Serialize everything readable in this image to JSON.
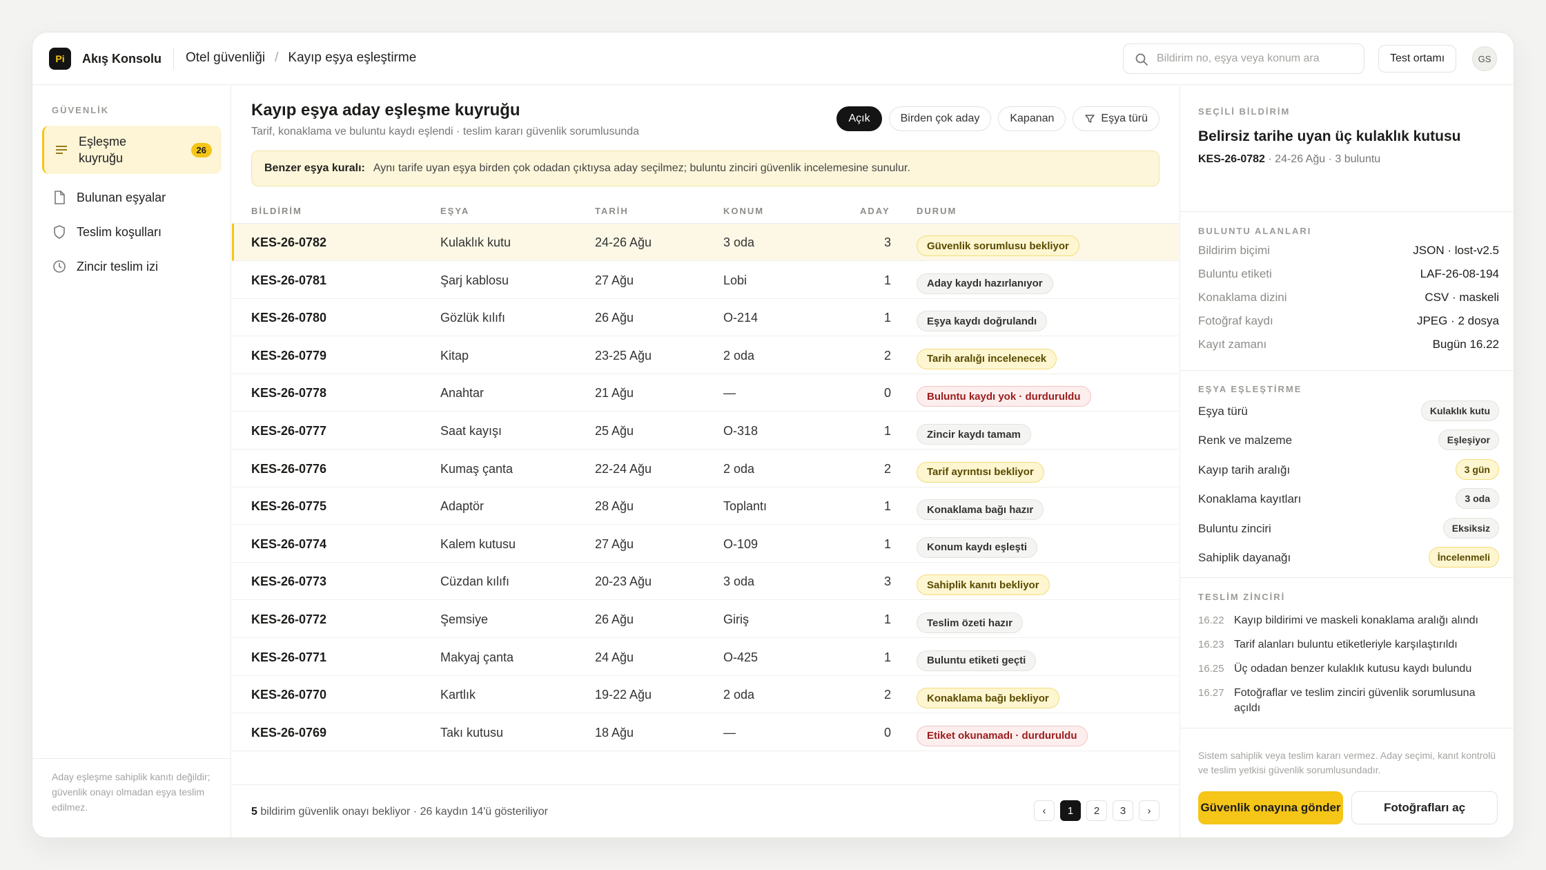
{
  "app": {
    "logo_text": "Pi",
    "name": "Akış Konsolu"
  },
  "breadcrumb": [
    "Otel güvenliği",
    "Kayıp eşya eşleştirme"
  ],
  "search": {
    "placeholder": "Bildirim no, eşya veya konum ara"
  },
  "env_button": "Test ortamı",
  "avatar": "GS",
  "sidebar": {
    "section": "GÜVENLİK",
    "items": [
      {
        "label": "Eşleşme kuyruğu",
        "icon": "list-icon",
        "badge": "26",
        "active": true
      },
      {
        "label": "Bulunan eşyalar",
        "icon": "file-icon"
      },
      {
        "label": "Teslim koşulları",
        "icon": "shield-icon"
      },
      {
        "label": "Zincir teslim izi",
        "icon": "clock-icon"
      }
    ],
    "footer": "Aday eşleşme sahiplik kanıtı değildir; güvenlik onayı olmadan eşya teslim edilmez."
  },
  "main": {
    "title": "Kayıp eşya aday eşleşme kuyruğu",
    "subtitle": "Tarif, konaklama ve buluntu kaydı eşlendi · teslim kararı güvenlik sorumlusunda",
    "filters": [
      "Açık",
      "Birden çok aday",
      "Kapanan",
      "Eşya türü"
    ],
    "rule_label": "Benzer eşya kuralı:",
    "rule_text": "Aynı tarife uyan eşya birden çok odadan çıktıysa aday seçilmez; buluntu zinciri güvenlik incelemesine sunulur.",
    "columns": [
      "BİLDİRİM",
      "EŞYA",
      "TARİH",
      "KONUM",
      "ADAY",
      "DURUM"
    ],
    "rows": [
      {
        "id": "KES-26-0782",
        "item": "Kulaklık kutu",
        "date": "24-26 Ağu",
        "loc": "3 oda",
        "count": "3",
        "status": "Güvenlik sorumlusu bekliyor",
        "tone": "y"
      },
      {
        "id": "KES-26-0781",
        "item": "Şarj kablosu",
        "date": "27 Ağu",
        "loc": "Lobi",
        "count": "1",
        "status": "Aday kaydı hazırlanıyor",
        "tone": "n"
      },
      {
        "id": "KES-26-0780",
        "item": "Gözlük kılıfı",
        "date": "26 Ağu",
        "loc": "O-214",
        "count": "1",
        "status": "Eşya kaydı doğrulandı",
        "tone": "n"
      },
      {
        "id": "KES-26-0779",
        "item": "Kitap",
        "date": "23-25 Ağu",
        "loc": "2 oda",
        "count": "2",
        "status": "Tarih aralığı incelenecek",
        "tone": "y"
      },
      {
        "id": "KES-26-0778",
        "item": "Anahtar",
        "date": "21 Ağu",
        "loc": "—",
        "count": "0",
        "status": "Buluntu kaydı yok · durduruldu",
        "tone": "r"
      },
      {
        "id": "KES-26-0777",
        "item": "Saat kayışı",
        "date": "25 Ağu",
        "loc": "O-318",
        "count": "1",
        "status": "Zincir kaydı tamam",
        "tone": "n"
      },
      {
        "id": "KES-26-0776",
        "item": "Kumaş çanta",
        "date": "22-24 Ağu",
        "loc": "2 oda",
        "count": "2",
        "status": "Tarif ayrıntısı bekliyor",
        "tone": "y"
      },
      {
        "id": "KES-26-0775",
        "item": "Adaptör",
        "date": "28 Ağu",
        "loc": "Toplantı",
        "count": "1",
        "status": "Konaklama bağı hazır",
        "tone": "n"
      },
      {
        "id": "KES-26-0774",
        "item": "Kalem kutusu",
        "date": "27 Ağu",
        "loc": "O-109",
        "count": "1",
        "status": "Konum kaydı eşleşti",
        "tone": "n"
      },
      {
        "id": "KES-26-0773",
        "item": "Cüzdan kılıfı",
        "date": "20-23 Ağu",
        "loc": "3 oda",
        "count": "3",
        "status": "Sahiplik kanıtı bekliyor",
        "tone": "y"
      },
      {
        "id": "KES-26-0772",
        "item": "Şemsiye",
        "date": "26 Ağu",
        "loc": "Giriş",
        "count": "1",
        "status": "Teslim özeti hazır",
        "tone": "n"
      },
      {
        "id": "KES-26-0771",
        "item": "Makyaj çanta",
        "date": "24 Ağu",
        "loc": "O-425",
        "count": "1",
        "status": "Buluntu etiketi geçti",
        "tone": "n"
      },
      {
        "id": "KES-26-0770",
        "item": "Kartlık",
        "date": "19-22 Ağu",
        "loc": "2 oda",
        "count": "2",
        "status": "Konaklama bağı bekliyor",
        "tone": "y"
      },
      {
        "id": "KES-26-0769",
        "item": "Takı kutusu",
        "date": "18 Ağu",
        "loc": "—",
        "count": "0",
        "status": "Etiket okunamadı · durduruldu",
        "tone": "r"
      }
    ],
    "footer_count": "5",
    "footer_text": "bildirim güvenlik onayı bekliyor · 26 kaydın 14'ü gösteriliyor",
    "pages": [
      "‹",
      "1",
      "2",
      "3",
      "›"
    ],
    "current_page": "1"
  },
  "detail": {
    "section": "SEÇİLİ BİLDİRİM",
    "title": "Belirsiz tarihe uyan üç kulaklık kutusu",
    "id": "KES-26-0782",
    "meta": "· 24-26 Ağu · 3 buluntu",
    "fields_title": "BULUNTU ALANLARI",
    "fields": [
      {
        "k": "Bildirim biçimi",
        "v": "JSON · lost-v2.5"
      },
      {
        "k": "Buluntu etiketi",
        "v": "LAF-26-08-194"
      },
      {
        "k": "Konaklama dizini",
        "v": "CSV · maskeli"
      },
      {
        "k": "Fotoğraf kaydı",
        "v": "JPEG · 2 dosya"
      },
      {
        "k": "Kayıt zamanı",
        "v": "Bugün 16.22"
      }
    ],
    "match_title": "EŞYA EŞLEŞTİRME",
    "matches": [
      {
        "k": "Eşya türü",
        "v": "Kulaklık kutu",
        "tone": "n"
      },
      {
        "k": "Renk ve malzeme",
        "v": "Eşleşiyor",
        "tone": "n"
      },
      {
        "k": "Kayıp tarih aralığı",
        "v": "3 gün",
        "tone": "y"
      },
      {
        "k": "Konaklama kayıtları",
        "v": "3 oda",
        "tone": "n"
      },
      {
        "k": "Buluntu zinciri",
        "v": "Eksiksiz",
        "tone": "n"
      },
      {
        "k": "Sahiplik dayanağı",
        "v": "İncelenmeli",
        "tone": "y"
      }
    ],
    "chain_title": "TESLİM ZİNCİRİ",
    "chain": [
      {
        "t": "16.22",
        "text": "Kayıp bildirimi ve maskeli konaklama aralığı alındı"
      },
      {
        "t": "16.23",
        "text": "Tarif alanları buluntu etiketleriyle karşılaştırıldı"
      },
      {
        "t": "16.25",
        "text": "Üç odadan benzer kulaklık kutusu kaydı bulundu"
      },
      {
        "t": "16.27",
        "text": "Fotoğraflar ve teslim zinciri güvenlik sorumlusuna açıldı"
      }
    ],
    "note": "Sistem sahiplik veya teslim kararı vermez. Aday seçimi, kanıt kontrolü ve teslim yetkisi güvenlik sorumlusundadır.",
    "primary_button": "Güvenlik onayına gönder",
    "secondary_button": "Fotoğrafları aç"
  }
}
